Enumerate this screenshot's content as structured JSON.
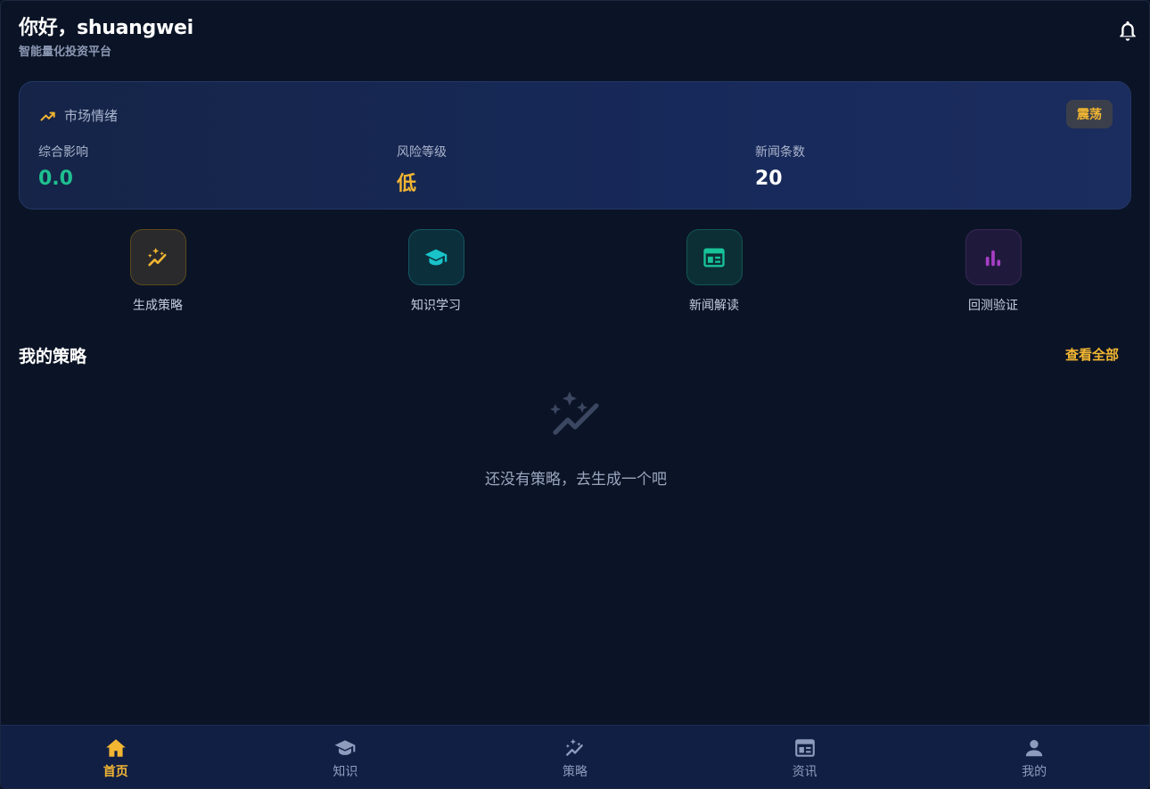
{
  "header": {
    "greeting": "你好，shuangwei",
    "subtitle": "智能量化投资平台"
  },
  "sentiment": {
    "title": "市场情绪",
    "badge": "震荡",
    "metrics": [
      {
        "label": "综合影响",
        "value": "0.0",
        "color": "#1fbf8f"
      },
      {
        "label": "风险等级",
        "value": "低",
        "color": "#f2b632"
      },
      {
        "label": "新闻条数",
        "value": "20",
        "color": "#ffffff"
      }
    ]
  },
  "actions": [
    {
      "label": "生成策略",
      "icon": "sparkle-chart-icon",
      "color": "#f2b632"
    },
    {
      "label": "知识学习",
      "icon": "graduation-cap-icon",
      "color": "#18c3c9"
    },
    {
      "label": "新闻解读",
      "icon": "newspaper-icon",
      "color": "#18c39a"
    },
    {
      "label": "回测验证",
      "icon": "bar-chart-icon",
      "color": "#a63ec6"
    }
  ],
  "strategies": {
    "title": "我的策略",
    "view_all": "查看全部",
    "empty_text": "还没有策略，去生成一个吧"
  },
  "nav": {
    "active_color": "#f2b632",
    "items": [
      {
        "label": "首页",
        "icon": "home-icon"
      },
      {
        "label": "知识",
        "icon": "graduation-cap-icon"
      },
      {
        "label": "策略",
        "icon": "sparkle-chart-icon"
      },
      {
        "label": "资讯",
        "icon": "newspaper-icon"
      },
      {
        "label": "我的",
        "icon": "person-icon"
      }
    ]
  }
}
